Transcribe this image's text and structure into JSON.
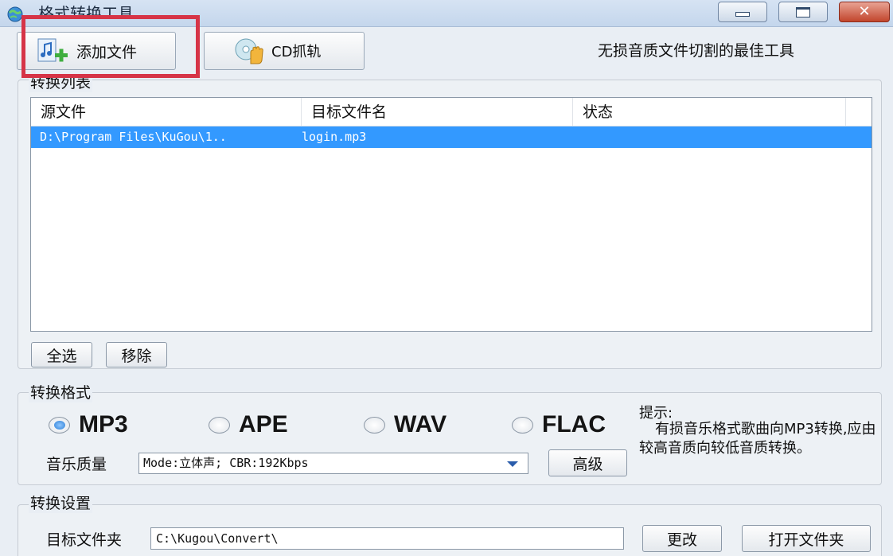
{
  "window": {
    "title": "格式转换工具",
    "close_glyph": "✕"
  },
  "toolbar": {
    "add_file_label": "添加文件",
    "cd_rip_label": "CD抓轨",
    "slogan": "无损音质文件切割的最佳工具"
  },
  "convert_list": {
    "group_title": "转换列表",
    "columns": [
      "源文件",
      "目标文件名",
      "状态"
    ],
    "rows": [
      {
        "source": "D:\\Program Files\\KuGou\\1..",
        "target": "login.mp3",
        "status": ""
      }
    ],
    "select_all_label": "全选",
    "remove_label": "移除"
  },
  "convert_format": {
    "group_title": "转换格式",
    "options": [
      "MP3",
      "APE",
      "WAV",
      "FLAC"
    ],
    "selected": "MP3",
    "quality_label": "音乐质量",
    "quality_value": "Mode:立体声; CBR:192Kbps",
    "advanced_label": "高级",
    "tip_title": "提示:",
    "tip_text": "有损音乐格式歌曲向MP3转换,应由较高音质向较低音质转换。"
  },
  "convert_settings": {
    "group_title": "转换设置",
    "target_folder_label": "目标文件夹",
    "target_folder_value": "C:\\Kugou\\Convert\\",
    "change_label": "更改",
    "open_folder_label": "打开文件夹"
  },
  "colors": {
    "selection": "#3399ff",
    "highlight_box": "#d63447",
    "window_bg": "#e9eef4"
  }
}
